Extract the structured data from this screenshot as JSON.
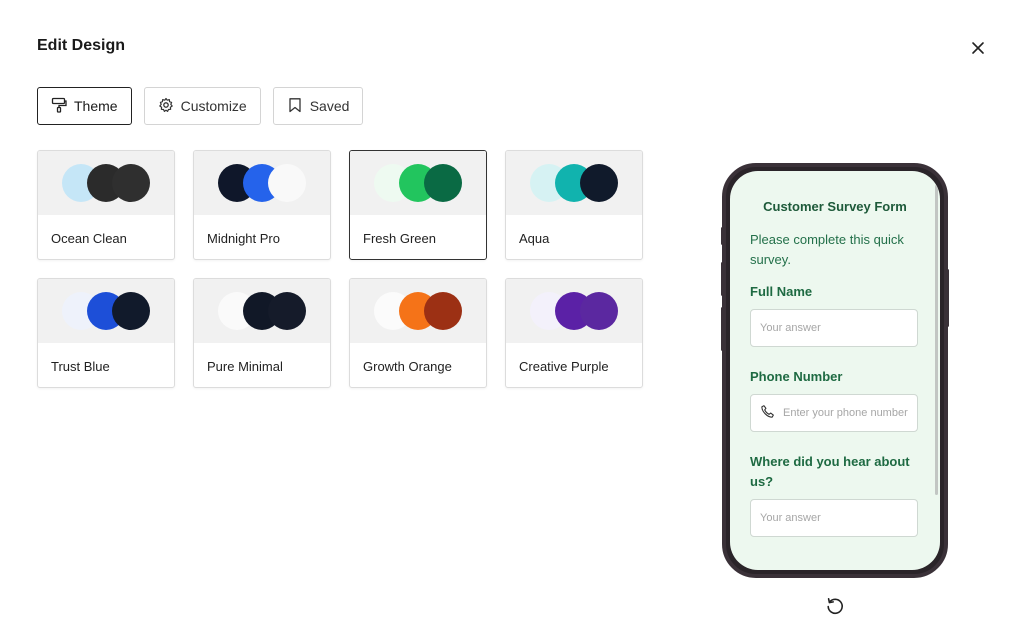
{
  "header": {
    "title": "Edit Design"
  },
  "tabs": [
    {
      "label": "Theme",
      "icon": "paint-roller-icon",
      "active": true
    },
    {
      "label": "Customize",
      "icon": "gear-icon",
      "active": false
    },
    {
      "label": "Saved",
      "icon": "bookmark-icon",
      "active": false
    }
  ],
  "themes": [
    {
      "name": "Ocean Clean",
      "colors": [
        "#c5e6f7",
        "#2b2b2b",
        "#2f2f2f"
      ],
      "selected": false
    },
    {
      "name": "Midnight Pro",
      "colors": [
        "#0f172a",
        "#2563eb",
        "#f9f9f9"
      ],
      "selected": false
    },
    {
      "name": "Fresh Green",
      "colors": [
        "#eefaf1",
        "#22c55e",
        "#0a6a44"
      ],
      "selected": true
    },
    {
      "name": "Aqua",
      "colors": [
        "#d6f2f3",
        "#11b3ae",
        "#101a2b"
      ],
      "selected": false
    },
    {
      "name": "Trust Blue",
      "colors": [
        "#eef2fb",
        "#1d4fd8",
        "#111a2b"
      ],
      "selected": false
    },
    {
      "name": "Pure Minimal",
      "colors": [
        "#fafafa",
        "#111827",
        "#151b2a"
      ],
      "selected": false
    },
    {
      "name": "Growth Orange",
      "colors": [
        "#fbfbfb",
        "#f57318",
        "#9c3014"
      ],
      "selected": false
    },
    {
      "name": "Creative Purple",
      "colors": [
        "#f3f1fb",
        "#5b21a6",
        "#5b28a0"
      ],
      "selected": false
    }
  ],
  "preview": {
    "form_title": "Customer Survey Form",
    "description": "Please complete this quick survey.",
    "questions": [
      {
        "label": "Full Name",
        "placeholder": "Your answer",
        "icon": ""
      },
      {
        "label": "Phone Number",
        "placeholder": "Enter your phone number",
        "icon": "phone-icon"
      },
      {
        "label": "Where did you hear about us?",
        "placeholder": "Your answer",
        "icon": ""
      }
    ],
    "colors": {
      "background": "#edf8ef",
      "title": "#1e5a3a",
      "text": "#23704a"
    }
  },
  "icons": {
    "close": "close-icon",
    "refresh": "refresh-icon"
  }
}
